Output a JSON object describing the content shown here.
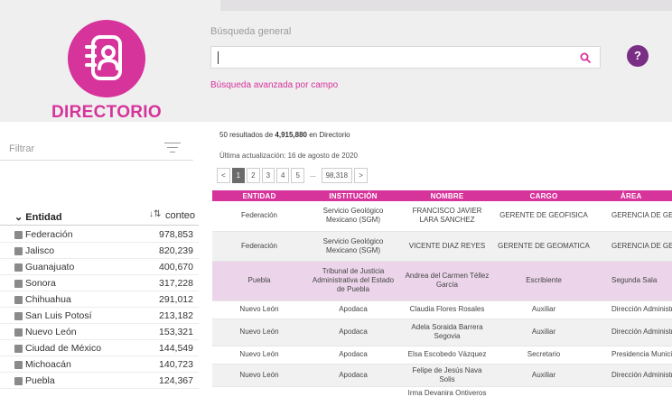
{
  "header": {
    "logo_label": "DIRECTORIO",
    "search_title": "Búsqueda general",
    "search_value": "",
    "advanced_link": "Búsqueda avanzada por campo",
    "help_label": "?"
  },
  "colors": {
    "accent": "#d6339b",
    "help": "#7a2e86",
    "highlight_row": "#ecd5ea"
  },
  "sidebar": {
    "filter_placeholder": "Filtrar",
    "facet_title": "Entidad",
    "count_label": "conteo",
    "items": [
      {
        "name": "Federación",
        "count": "978,853"
      },
      {
        "name": "Jalisco",
        "count": "820,239"
      },
      {
        "name": "Guanajuato",
        "count": "400,670"
      },
      {
        "name": "Sonora",
        "count": "317,228"
      },
      {
        "name": "Chihuahua",
        "count": "291,012"
      },
      {
        "name": "San Luis Potosí",
        "count": "213,182"
      },
      {
        "name": "Nuevo León",
        "count": "153,321"
      },
      {
        "name": "Ciudad de México",
        "count": "144,549"
      },
      {
        "name": "Michoacán",
        "count": "140,723"
      },
      {
        "name": "Puebla",
        "count": "124,367"
      }
    ]
  },
  "results": {
    "count": "50",
    "prefix": "resultados de",
    "total": "4,915,880",
    "suffix": "en Directorio",
    "last_update": "Última actualización: 16 de agosto de 2020",
    "pagination": [
      "<",
      "1",
      "2",
      "3",
      "4",
      "5",
      "...",
      "98,318",
      ">"
    ]
  },
  "table": {
    "columns": [
      "ENTIDAD",
      "INSTITUCIÓN",
      "NOMBRE",
      "CARGO",
      "ÁREA"
    ],
    "rows": [
      [
        "Federación",
        "Servicio Geológico Mexicano (SGM)",
        "FRANCISCO JAVIER LARA SANCHEZ",
        "GERENTE DE GEOFISICA",
        "GERENCIA DE GEOFISICA"
      ],
      [
        "Federación",
        "Servicio Geológico Mexicano (SGM)",
        "VICENTE DIAZ REYES",
        "GERENTE DE GEOMATICA",
        "GERENCIA DE GEOMATICA"
      ],
      [
        "Puebla",
        "Tribunal de Justicia Administrativa del Estado de Puebla",
        "Andrea del Carmen Téllez García",
        "Escribiente",
        "Segunda Sala"
      ],
      [
        "Nuevo León",
        "Apodaca",
        "Claudia Flores Rosales",
        "Auxiliar",
        "Dirección Administrativa"
      ],
      [
        "Nuevo León",
        "Apodaca",
        "Adela Soraida Barrera Segovia",
        "Auxiliar",
        "Dirección Administrativa"
      ],
      [
        "Nuevo León",
        "Apodaca",
        "Elsa Escobedo Vázquez",
        "Secretario",
        "Presidencia Municipal"
      ],
      [
        "Nuevo León",
        "Apodaca",
        "Felipe de Jesús Nava Solis",
        "Auxiliar",
        "Dirección Administrativa"
      ],
      [
        "",
        "",
        "Irma Devanira Ontiveros",
        "",
        ""
      ]
    ]
  }
}
